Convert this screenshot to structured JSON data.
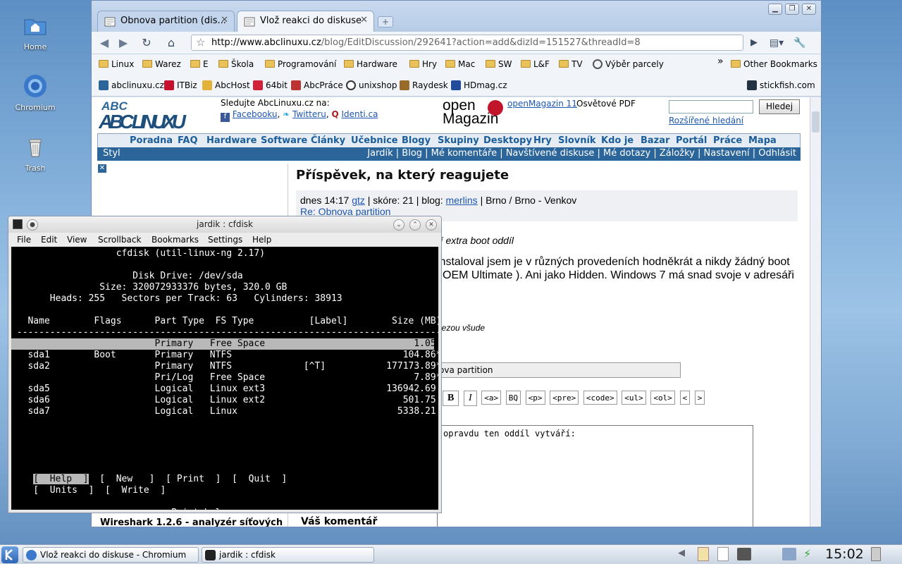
{
  "desktop": {
    "icons": [
      {
        "label": "Home"
      },
      {
        "label": "Chromium"
      },
      {
        "label": "Trash"
      }
    ]
  },
  "browser": {
    "tabs": [
      {
        "label": "Obnova partition (dis...",
        "active": false
      },
      {
        "label": "Vlož reakci do diskuse",
        "active": true
      }
    ],
    "url_host": "http://www.abclinuxu.cz",
    "url_path": "/blog/EditDiscussion/292641?action=add&dizId=151527&threadId=8",
    "bookmarks_row1": [
      "Linux",
      "Warez",
      "E",
      "Škola",
      "Programování",
      "Hardware",
      "Hry",
      "Mac",
      "SW",
      "L&F",
      "TV",
      "Výběr parcely",
      "»",
      "Other Bookmarks"
    ],
    "bookmarks_row2": [
      "abclinuxu.cz",
      "ITBiz",
      "AbcHost",
      "64bit",
      "AbcPráce",
      "unixshop",
      "Raydesk",
      "HDmag.cz",
      "stickfish.com"
    ]
  },
  "site": {
    "logo_text": "ABC LINUXU",
    "follow_title": "Sledujte AbcLinuxu.cz na:",
    "follow_links": [
      "Facebooku",
      "Twitteru",
      "Identi.ca"
    ],
    "om_logo_top": "open",
    "om_logo_bottom": "Magazin",
    "om_link": "openMagazin 11",
    "om_pdf": "Osvětové PDF",
    "search_button": "Hledej",
    "search_placeholder": "",
    "advanced_search": "Rozšířené hledání",
    "nav": [
      "Poradna",
      "FAQ",
      "Hardware",
      "Software",
      "Články",
      "Učebnice",
      "Blogy",
      "Skupiny",
      "Desktopy",
      "Hry",
      "Slovník",
      "Kdo je",
      "Bazar",
      "Portál",
      "Práce",
      "Mapa"
    ],
    "subnav_left": "Styl",
    "subnav_right": "Jardík | Blog | Mé komentáře | Navštívené diskuse | Mé dotazy | Záložky | Nastavení | Odhlásit",
    "heading": "Příspěvek, na který reagujete",
    "post_meta_time": "dnes 14:17",
    "post_meta_user": "gtz",
    "post_meta_score": "| skóre: 21 | blog:",
    "post_meta_blog": "merlins",
    "post_meta_loc": "| Brno / Brno - Venkov",
    "post_subject": "Re: Obnova partition",
    "post_quote_tail": "ří extra boot oddíl",
    "post_text_1": "instaloval jsem je v různých provedeních hodněkrát a nikdy žádný boot",
    "post_text_2": "i OEM Ultimate ). Ani jako Hidden. Windows 7 má snad svoje v adresáři",
    "post_small": "rlezou všude",
    "subject_field_tail": "ova partition",
    "editor_buttons": [
      "B",
      "I",
      "<a>",
      "BQ",
      "<p>",
      "<pre>",
      "<code>",
      "<ul>",
      "<ol>",
      "<",
      ">"
    ],
    "textarea_tail": "opravdu ten oddíl vytváří:",
    "sidebar_bottom": "Wireshark 1.2.6 - analyzér síťových",
    "comment_label": "Váš komentář"
  },
  "konsole": {
    "title": "jardik : cfdisk",
    "menu": [
      "File",
      "Edit",
      "View",
      "Scrollback",
      "Bookmarks",
      "Settings",
      "Help"
    ],
    "lines": [
      "                   cfdisk (util-linux-ng 2.17)",
      "",
      "                      Disk Drive: /dev/sda",
      "                Size: 320072933376 bytes, 320.0 GB",
      "       Heads: 255   Sectors per Track: 63   Cylinders: 38913",
      "",
      "   Name        Flags      Part Type  FS Type          [Label]        Size (MB)",
      " ------------------------------------------------------------------------------",
      "                          Primary   Free Space                           1.05*",
      "   sda1        Boot       Primary   NTFS                               104.86*",
      "   sda2                   Primary   NTFS             [^T]           177173.89*",
      "                          Pri/Log   Free Space                           7.89*",
      "   sda5                   Logical   Linux ext3                      136942.69",
      "   sda6                   Logical   Linux ext2                         501.75",
      "   sda7                   Logical   Linux                             5338.21",
      "",
      "",
      "",
      "",
      "",
      "    [  Help  ]  [  New   ]  [ Print  ]  [  Quit  ]",
      "    [  Units  ]  [  Write  ]",
      "",
      "                             Print help screen"
    ],
    "highlight_row": 8
  },
  "taskbar": {
    "tasks": [
      "Vlož reakci do diskuse - Chromium",
      "jardik : cfdisk"
    ],
    "clock": "15:02"
  }
}
